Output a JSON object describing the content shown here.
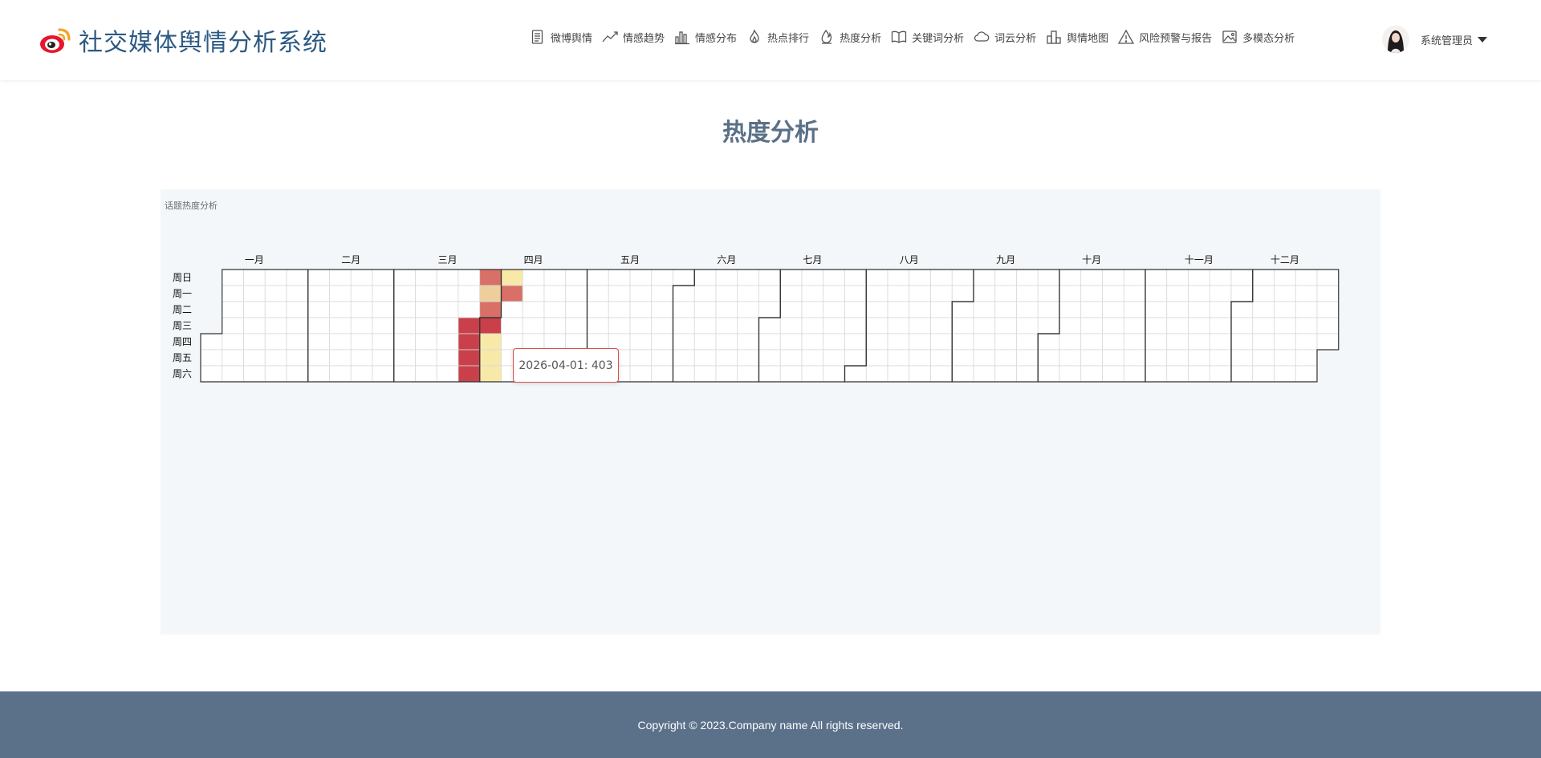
{
  "header": {
    "title": "社交媒体舆情分析系统",
    "logo_icon": "weibo-logo-icon",
    "nav": [
      {
        "id": "weibo",
        "label": "微博舆情",
        "icon": "document-icon"
      },
      {
        "id": "trend",
        "label": "情感趋势",
        "icon": "trend-line-icon"
      },
      {
        "id": "dist",
        "label": "情感分布",
        "icon": "bar-chart-icon"
      },
      {
        "id": "hot",
        "label": "热点排行",
        "icon": "flame-icon"
      },
      {
        "id": "heat",
        "label": "热度分析",
        "icon": "fire-icon"
      },
      {
        "id": "keyword",
        "label": "关键词分析",
        "icon": "book-icon"
      },
      {
        "id": "cloud",
        "label": "词云分析",
        "icon": "cloud-icon"
      },
      {
        "id": "map",
        "label": "舆情地图",
        "icon": "buildings-icon"
      },
      {
        "id": "warning",
        "label": "风险预警与报告",
        "icon": "warning-icon"
      },
      {
        "id": "multi",
        "label": "多模态分析",
        "icon": "image-icon"
      }
    ],
    "user": {
      "name": "系统管理员",
      "avatar_icon": "user-avatar"
    }
  },
  "page_title": "热度分析",
  "panel": {
    "label": "话题热度分析"
  },
  "tooltip": {
    "text": "2026-04-01: 403"
  },
  "footer": {
    "copyright": "Copyright © 2023.Company name All rights reserved."
  },
  "colors": {
    "brand": "#2c5a82",
    "title": "#5b7087",
    "footer": "#5a7189",
    "panel": "#f3f7fa",
    "heat_scale": [
      "#f8e9a8",
      "#eecf9b",
      "#e39a7c",
      "#d87068",
      "#c9404a"
    ]
  },
  "chart_data": {
    "type": "heatmap",
    "title": "话题热度分析",
    "year": 2026,
    "months": [
      "一月",
      "二月",
      "三月",
      "四月",
      "五月",
      "六月",
      "七月",
      "八月",
      "九月",
      "十月",
      "十一月",
      "十二月"
    ],
    "weekdays": [
      "周日",
      "周一",
      "周二",
      "周三",
      "周四",
      "周五",
      "周六"
    ],
    "value_range": [
      0,
      500
    ],
    "values": [
      {
        "date": "2026-03-25",
        "value": 460
      },
      {
        "date": "2026-03-26",
        "value": 480
      },
      {
        "date": "2026-03-27",
        "value": 470
      },
      {
        "date": "2026-03-28",
        "value": 440
      },
      {
        "date": "2026-03-29",
        "value": 300
      },
      {
        "date": "2026-03-30",
        "value": 190
      },
      {
        "date": "2026-03-31",
        "value": 360
      },
      {
        "date": "2026-04-01",
        "value": 403
      },
      {
        "date": "2026-04-02",
        "value": 60
      },
      {
        "date": "2026-04-03",
        "value": 50
      },
      {
        "date": "2026-04-04",
        "value": 40
      },
      {
        "date": "2026-04-05",
        "value": 70
      },
      {
        "date": "2026-04-06",
        "value": 350
      }
    ]
  }
}
